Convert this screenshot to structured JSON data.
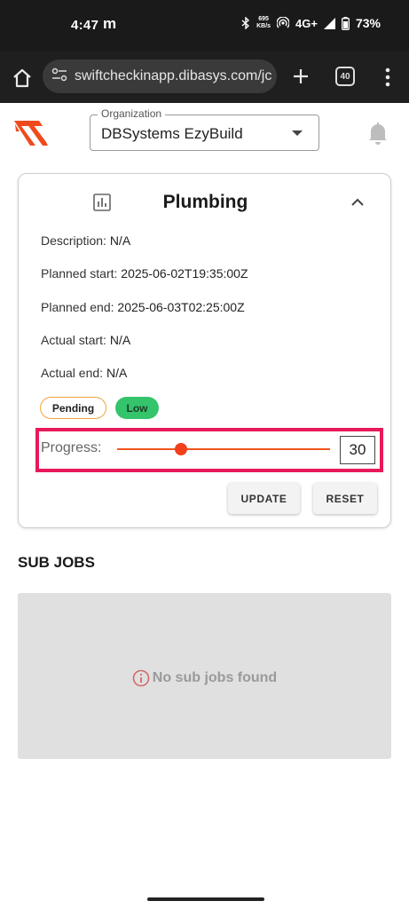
{
  "status_bar": {
    "time": "4:47",
    "app_glyph": "m",
    "net_speed_value": "695",
    "net_speed_unit": "KB/s",
    "network": "4G+",
    "battery": "73%"
  },
  "browser": {
    "url": "swiftcheckinapp.dibasys.com/jc",
    "tab_count": "40"
  },
  "header": {
    "org_label": "Organization",
    "org_value": "DBSystems EzyBuild"
  },
  "job": {
    "title": "Plumbing",
    "description_label": "Description:",
    "description": "N/A",
    "planned_start_label": "Planned start:",
    "planned_start": "2025-06-02T19:35:00Z",
    "planned_end_label": "Planned end:",
    "planned_end": "2025-06-03T02:25:00Z",
    "actual_start_label": "Actual start:",
    "actual_start": "N/A",
    "actual_end_label": "Actual end:",
    "actual_end": "N/A",
    "status_chip": "Pending",
    "priority_chip": "Low",
    "progress_label": "Progress:",
    "progress_value": "30",
    "update_label": "UPDATE",
    "reset_label": "RESET"
  },
  "sub_jobs": {
    "title": "SUB JOBS",
    "empty_message": "No sub jobs found"
  },
  "colors": {
    "accent": "#f3401c",
    "highlight_border": "#e8195a",
    "pending_border": "#f2a33a",
    "low_chip": "#34c46b"
  }
}
